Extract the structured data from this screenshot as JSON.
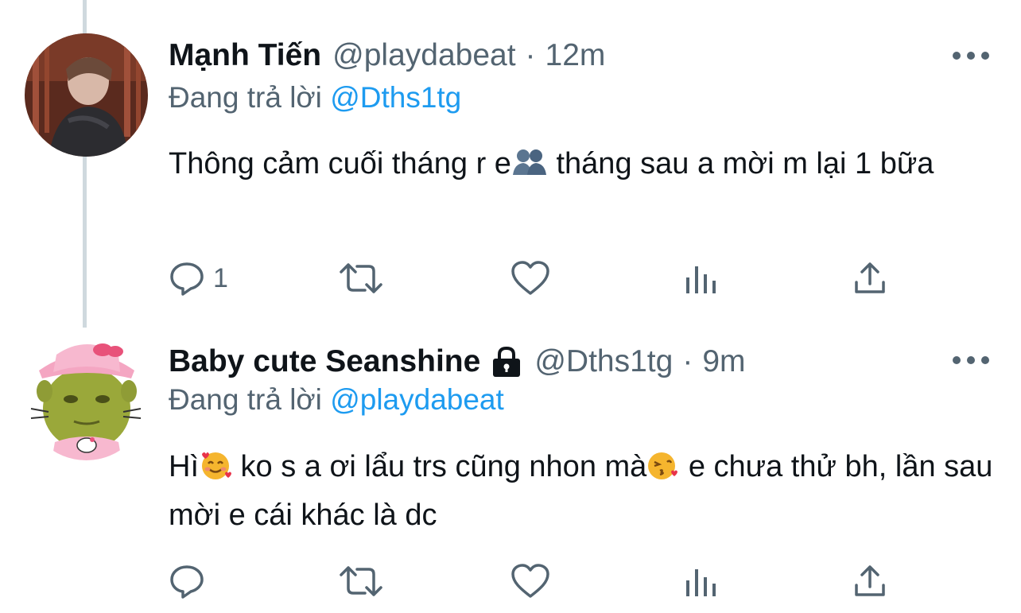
{
  "colors": {
    "text_primary": "#0f1419",
    "text_secondary": "#536471",
    "link": "#1d9bf0",
    "thread_line": "#cfd9de"
  },
  "tweets": [
    {
      "display_name": "Mạnh Tiến",
      "handle": "@playdabeat",
      "separator": "·",
      "time": "12m",
      "reply_prefix": "Đang trả lời",
      "reply_mention": "@Dths1tg",
      "text_part1": "Thông cảm cuối tháng r e",
      "emoji1": "people-silhouette-emoji",
      "text_part2": "  tháng sau a mời m lại 1 bữa",
      "reply_count": "1",
      "protected": false
    },
    {
      "display_name": "Baby cute Seanshine",
      "handle": "@Dths1tg",
      "separator": "·",
      "time": "9m",
      "reply_prefix": "Đang trả lời",
      "reply_mention": "@playdabeat",
      "text_part1": "Hì",
      "emoji1": "smiling-face-with-hearts-emoji",
      "text_part2": " ko s a ơi lẩu trs cũng nhon mà",
      "emoji2": "face-blowing-kiss-emoji",
      "text_part3": "  e chưa thử bh, lần sau mời e cái khác là dc",
      "reply_count": "",
      "protected": true
    }
  ],
  "icons": {
    "reply": "reply-icon",
    "retweet": "retweet-icon",
    "like": "like-icon",
    "analytics": "analytics-icon",
    "share": "share-icon",
    "more": "more-icon",
    "lock": "lock-icon"
  }
}
